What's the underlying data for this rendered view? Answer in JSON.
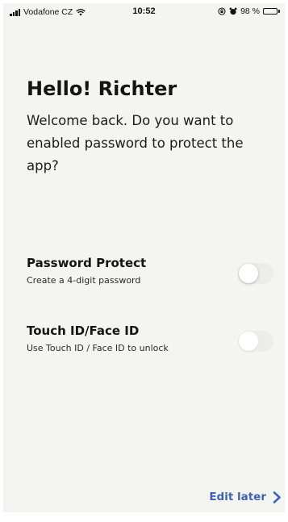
{
  "status_bar": {
    "carrier": "Vodafone CZ",
    "time": "10:52",
    "battery_percent": "98 %",
    "battery_level": 0.98,
    "icons": [
      "signal-icon",
      "wifi-icon",
      "orientation-lock-icon",
      "alarm-icon",
      "battery-icon"
    ]
  },
  "header": {
    "greeting": "Hello! Richter",
    "subtitle": "Welcome back. Do you want to enabled password to protect the app?"
  },
  "options": [
    {
      "title": "Password Protect",
      "description": "Create a 4-digit password",
      "enabled": false
    },
    {
      "title": "Touch ID/Face ID",
      "description": "Use Touch ID / Face ID to unlock",
      "enabled": false
    }
  ],
  "footer": {
    "edit_later_label": "Edit later",
    "icon": "chevron-right-icon"
  },
  "colors": {
    "background": "#f4f4f0",
    "accent": "#3f63b3",
    "text": "#141414",
    "toggle_off": "#ececea"
  }
}
